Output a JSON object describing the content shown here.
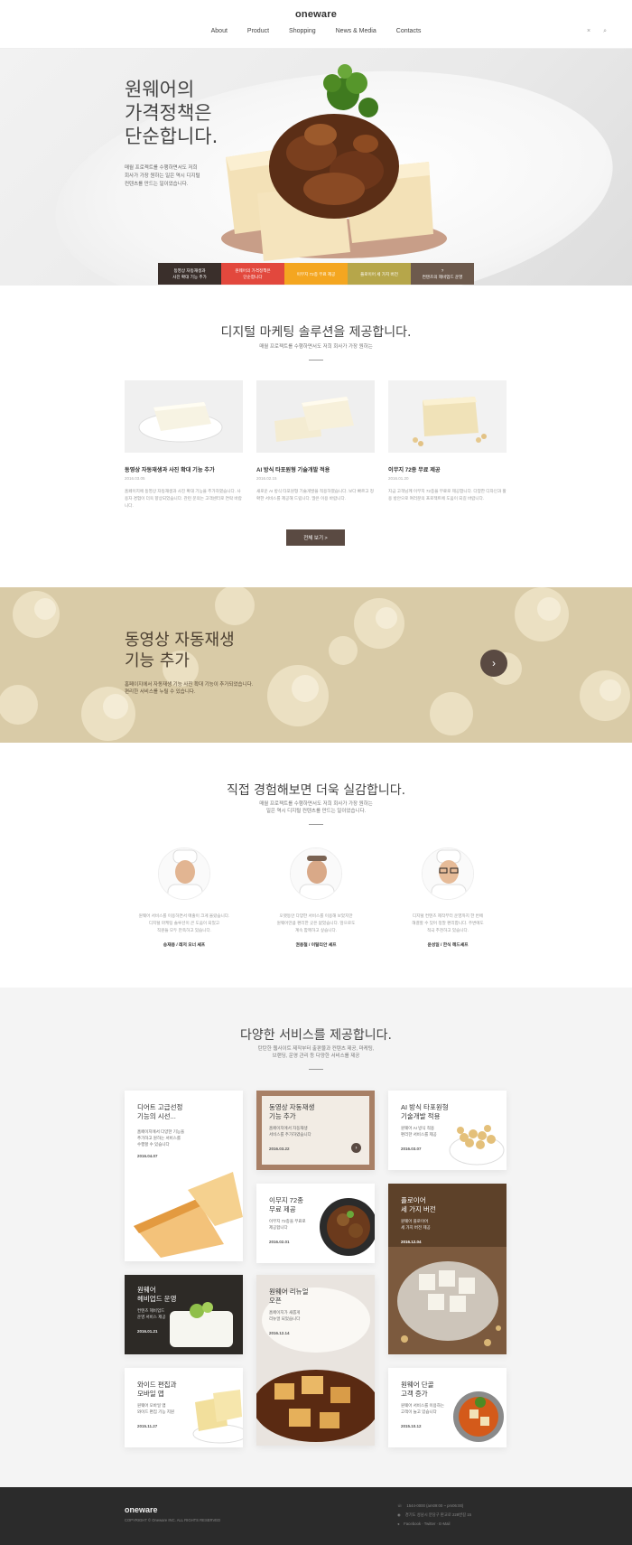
{
  "brand": {
    "logo": "oneware"
  },
  "nav": {
    "items": [
      "About",
      "Product",
      "Shopping",
      "News & Media",
      "Contacts"
    ]
  },
  "header_icons": [
    "×",
    "⌕"
  ],
  "hero": {
    "title": "원웨어의\n가격정책은\n단순합니다.",
    "desc": "매월 프로젝트를 수행하면서도 저희\n회사가 가장 원하는 일은 역시 디지털\n컨텐츠를 만드는 일이었습니다.",
    "tabs": [
      {
        "label": "동영상 자동재생과\n사진 확대 기능 추가",
        "color": "#3a2f2b"
      },
      {
        "label": "원웨어의 가격정책은\n단순합니다",
        "color": "#e2483d"
      },
      {
        "label": "이무지 72종 무료 제공",
        "color": "#f4a620"
      },
      {
        "label": "플로이어 세 가지 버전",
        "color": "#b6a64a"
      },
      {
        "label": "?\n컨텐츠의 헤비업드 운영",
        "color": "#6d5a4d"
      }
    ]
  },
  "solutions": {
    "title": "디지털 마케팅 솔루션을 제공합니다.",
    "subtitle": "매월 프로젝트를 수행하면서도 저희 회사가 가장 원하는",
    "cards": [
      {
        "title": "동영상 자동재생과 사진 확대 기능 추가",
        "date": "2016.03.05",
        "body": "홈페이지에 동영상 자동재생과 사진 확대 기능을 추가하였습니다. 사용자 경험이 더욱 향상되었습니다. 관련 문의는 고객센터로 연락 바랍니다."
      },
      {
        "title": "AI 방식 타포원형 기술개발 적용",
        "date": "2016.02.15",
        "body": "새로운 AI 방식 타포원형 기술개발을 적용하였습니다. 보다 빠르고 정확한 서비스를 제공해 드립니다. 많은 이용 바랍니다."
      },
      {
        "title": "이무지 72종 무료 제공",
        "date": "2016.01.20",
        "body": "지금 고객님께 이무지 72종을 무료로 제공합니다. 다양한 디자인과 활용 방안으로 여러분의 프로젝트에 도움이 되길 바랍니다."
      }
    ],
    "more_label": "전체 보기 >"
  },
  "banner": {
    "title": "동영상 자동재생\n기능 추가",
    "desc": "홈페이지에서 자동재생 기능 사진 확대 기능이 추가되었습니다.\n편리한 서비스를 누릴 수 있습니다.",
    "arrow": "›"
  },
  "testimonials": {
    "title": "직접 경험해보면 더욱 실감합니다.",
    "subtitle": "매월 프로젝트를 수행하면서도 저희 회사가 가장 원하는\n일은 역시 디지털 컨텐츠를 만드는 일이었습니다.",
    "people": [
      {
        "text": "원웨어 서비스를 이용하면서 매출이 크게 올랐습니다.\n디지털 마케팅 솔루션이 큰 도움이 되었고\n직원들 모두 만족하고 있습니다.",
        "name": "송재용 / 레저 오너 셰프"
      },
      {
        "text": "오랫동안 다양한 서비스를 이용해 보았지만\n원웨어만큼 편리한 곳은 없었습니다. 앞으로도\n계속 함께하고 싶습니다.",
        "name": "권용철 / 이탈리안 셰프"
      },
      {
        "text": "디지털 컨텐츠 제작부터 운영까지 한 번에\n해결할 수 있어 정말 편리합니다. 주변에도\n적극 추천하고 있습니다.",
        "name": "윤성일 / 한식 헤드셰프"
      }
    ]
  },
  "services": {
    "title": "다양한 서비스를 제공합니다.",
    "subtitle": "탄탄한 웹사이트 제작부터 출판물과 컨텐츠 제공, 마케팅,\n브랜딩, 운영 관리 등 다양한 서비스를 제공",
    "tiles": [
      {
        "title": "디어트 고급선정\n기능의 시선...",
        "desc": "홈페이지에서 다양한 기능을\n추가하고 원하는 서비스를\n수행할 수 있습니다",
        "date": "2016.04.07"
      },
      {
        "title": "동영상 자동재생\n기능 추가",
        "desc": "홈페이지에서 자동재생\n서비스를 추가하였습니다",
        "date": "2016.03.22"
      },
      {
        "title": "AI 방식 타포원형\n기술개발 적용",
        "desc": "원웨어 AI 방식 적용\n편리한 서비스를 제공",
        "date": "2016.03.07"
      },
      {
        "title": "이무지 72종\n무료 제공",
        "desc": "이무지 72종을 무료로\n제공합니다",
        "date": "2016.02.01"
      },
      {
        "title": "플로이어\n세 가지 버전",
        "desc": "원웨어 플로이어\n세 가지 버전 제공",
        "date": "2016.12.04"
      },
      {
        "title": "원웨어\n헤비업드 운영",
        "desc": "컨텐츠 헤비업드\n운영 서비스 제공",
        "date": "2016.01.21"
      },
      {
        "title": "원웨어 리뉴얼\n오픈",
        "desc": "홈페이지가 새롭게\n리뉴얼 되었습니다",
        "date": "2016.12.14"
      },
      {
        "title": "와이드 편집과\n모바일 앱",
        "desc": "원웨어 모바일 앱\n와이드 편집 기능 지원",
        "date": "2015.11.27"
      },
      {
        "title": "원웨어 단골\n고객 증가",
        "desc": "원웨어 서비스를 이용하는\n고객이 늘고 있습니다",
        "date": "2015.10.12"
      }
    ]
  },
  "footer": {
    "logo": "oneware",
    "copyright": "COPYRIGHT © Oneware INC. ALL RIGHTS RESERVED",
    "phone": "1544-0000 (am09:00 ~ pm06:00)",
    "address": "경기도 성남시 분당구 판교로 228번길 15",
    "links": "Facebook · Twitter · E-Mail"
  },
  "colors": {
    "accent": "#5a4a42",
    "footer_bg": "#2b2b2b",
    "services_bg": "#f4f4f4"
  }
}
